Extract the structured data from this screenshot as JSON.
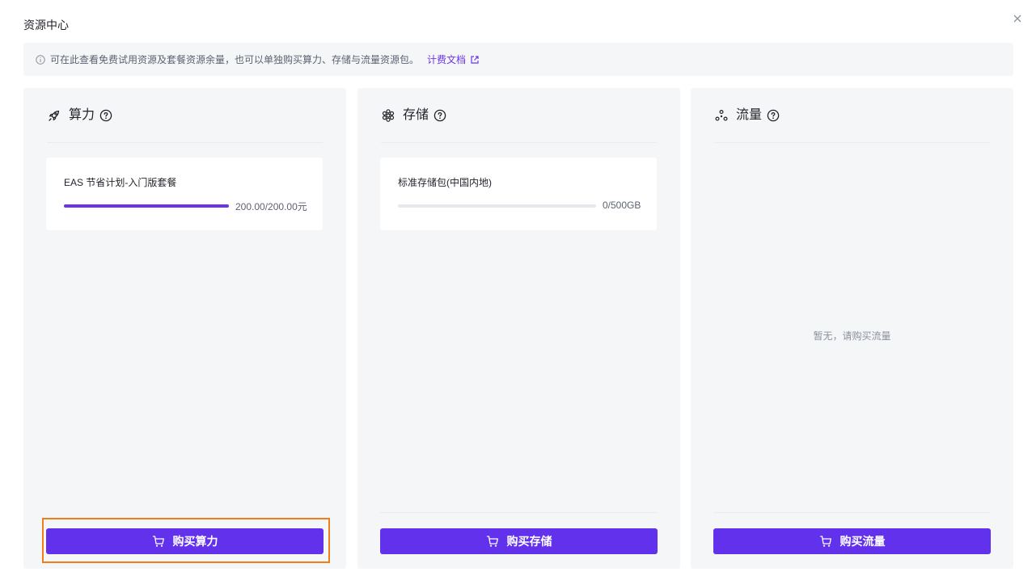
{
  "dialog": {
    "title": "资源中心",
    "close_icon": "close-icon"
  },
  "notice": {
    "text": "可在此查看免费试用资源及套餐资源余量，也可以单独购买算力、存储与流量资源包。",
    "link_label": "计费文档",
    "info_icon": "info-icon",
    "link_icon": "external-link-icon"
  },
  "panels": {
    "compute": {
      "title": "算力",
      "icon": "rocket-icon",
      "card_name": "EAS 节省计划-入门版套餐",
      "amount": "200.00/200.00元",
      "progress": 1.0,
      "button_label": "购买算力"
    },
    "storage": {
      "title": "存储",
      "icon": "storage-cluster-icon",
      "card_name": "标准存储包(中国内地)",
      "amount": "0/500GB",
      "progress": 0.0,
      "button_label": "购买存储"
    },
    "traffic": {
      "title": "流量",
      "icon": "traffic-nodes-icon",
      "empty_text": "暂无，请购买流量",
      "button_label": "购买流量"
    }
  },
  "colors": {
    "accent": "#6231ec",
    "progress_fill": "#6a35e6",
    "highlight": "#f07c1c"
  }
}
